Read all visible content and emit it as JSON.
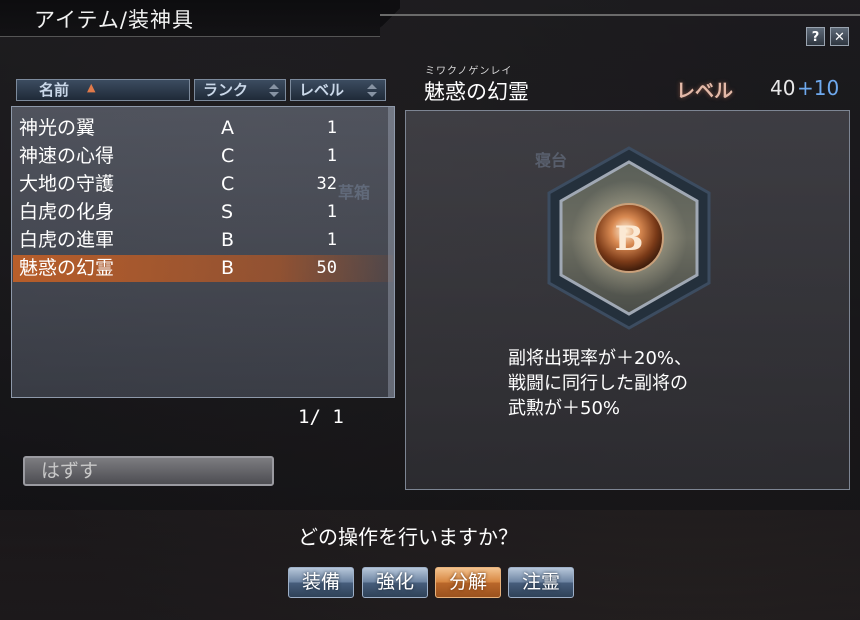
{
  "window": {
    "title": "アイテム/装神具",
    "help_label": "?",
    "close_label": "✕"
  },
  "list": {
    "headers": {
      "name": "名前",
      "rank": "ランク",
      "level": "レベル"
    },
    "rows": [
      {
        "name": "神光の翼",
        "rank": "A",
        "level": "1"
      },
      {
        "name": "神速の心得",
        "rank": "C",
        "level": "1"
      },
      {
        "name": "大地の守護",
        "rank": "C",
        "level": "32"
      },
      {
        "name": "白虎の化身",
        "rank": "S",
        "level": "1"
      },
      {
        "name": "白虎の進軍",
        "rank": "B",
        "level": "1"
      },
      {
        "name": "魅惑の幻霊",
        "rank": "B",
        "level": "50"
      }
    ],
    "selected_index": 5,
    "pagination": "1/  1",
    "remove_label": "はずす"
  },
  "detail": {
    "ruby": "ミワクノゲンレイ",
    "title": "魅惑の幻霊",
    "level_label": "レベル",
    "level_value": "40",
    "level_bonus": "+10",
    "emblem_letter": "B",
    "background_labels": [
      "寝台",
      "草箱"
    ],
    "description_lines": [
      "副将出現率が＋20%、",
      "戦闘に同行した副将の",
      "武勲が＋50%"
    ]
  },
  "action": {
    "prompt": "どの操作を行いますか？",
    "buttons": [
      {
        "label": "装備",
        "active": false
      },
      {
        "label": "強化",
        "active": false
      },
      {
        "label": "分解",
        "active": true
      },
      {
        "label": "注霊",
        "active": false
      }
    ]
  },
  "colors": {
    "selected_row": "#be5f28",
    "level_bonus": "#6ea9ee",
    "active_button": "#d78742"
  }
}
